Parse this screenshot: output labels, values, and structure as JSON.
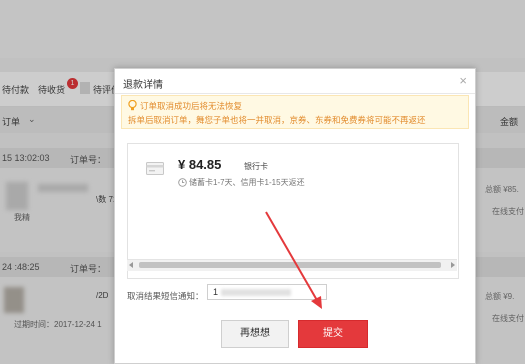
{
  "background": {
    "tabs": [
      "待付款",
      "待收货",
      "待评价"
    ],
    "tab_badge": "1",
    "table_header_left": "订单",
    "table_header_right": "金额",
    "orders": [
      {
        "time": "15 13:02:03",
        "order_no_label": "订单号：",
        "snippet": "\\数 710",
        "seller": "我精",
        "total": "总额 ¥85.",
        "pay_method": "在线支付"
      },
      {
        "time": "24 :48:25",
        "order_no_label": "订单号：",
        "snippet": "/2D",
        "expire": "过期时间：2017-12-24 1",
        "total": "总额 ¥9.",
        "pay_method": "在线支付"
      }
    ]
  },
  "modal": {
    "title": "退款详情",
    "close_glyph": "×",
    "notice_line1": "订单取消成功后将无法恢复",
    "notice_line2": "拆单后取消订单，舞您子单也将一并取消，京券、东券和免费券将可能不再返还",
    "refund": {
      "amount": "¥ 84.85",
      "method": "银行卡",
      "timing": "储蓄卡1-7天、信用卡1-15天返还"
    },
    "sms_label": "取消结果短信通知：",
    "sms_value": "1",
    "btn_think": "再想想",
    "btn_submit": "提交"
  },
  "colors": {
    "accent_red": "#e4393c",
    "notice_text": "#e28b2c",
    "notice_bg": "#fff9e3"
  },
  "icons": {
    "notice": "bulb-icon",
    "card": "bank-card-icon",
    "timing": "clock-icon",
    "close": "close-icon"
  }
}
